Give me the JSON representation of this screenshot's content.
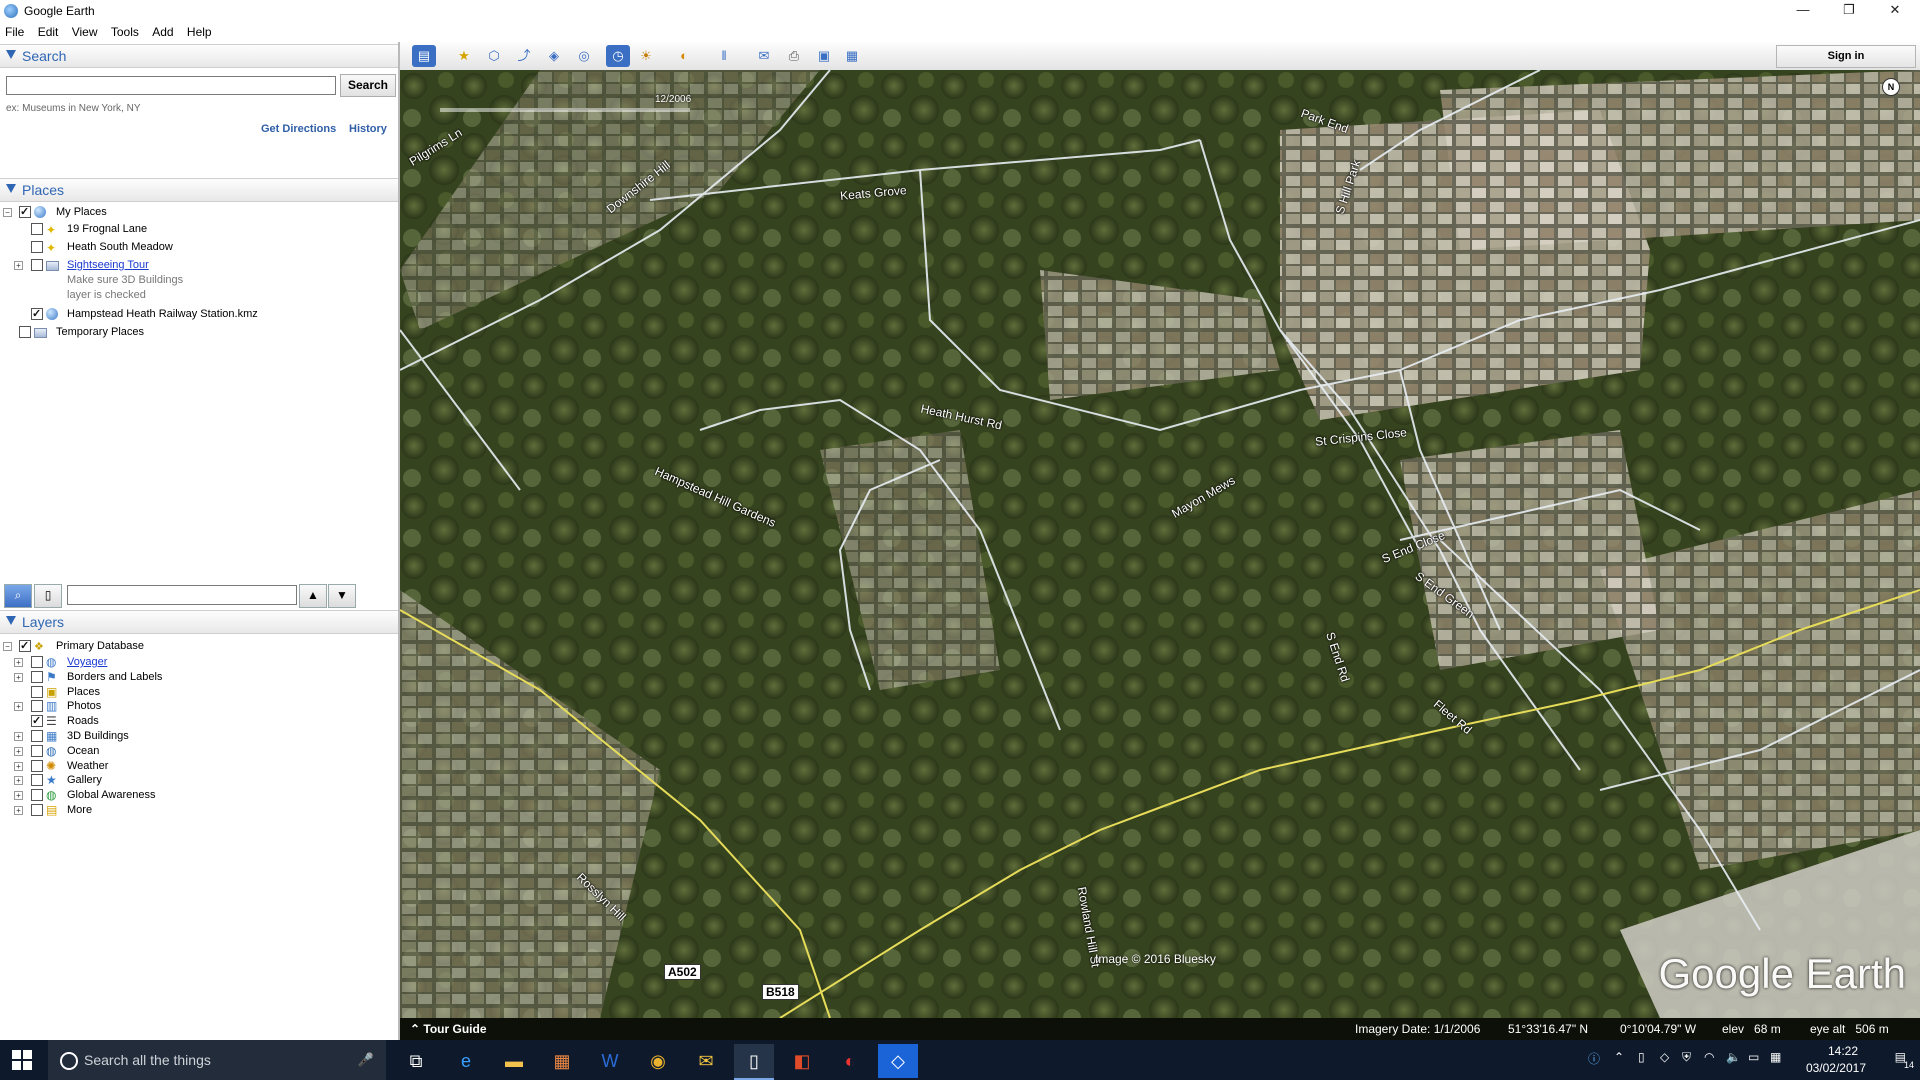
{
  "window": {
    "title": "Google Earth",
    "minimize": "—",
    "maximize": "❐",
    "close": "✕"
  },
  "menu": [
    "File",
    "Edit",
    "View",
    "Tools",
    "Add",
    "Help"
  ],
  "search": {
    "header": "Search",
    "button": "Search",
    "hint": "ex: Museums in New York, NY",
    "get_directions": "Get Directions",
    "history": "History",
    "value": ""
  },
  "places": {
    "header": "Places",
    "root": "My Places",
    "items": [
      {
        "label": "19 Frognal Lane",
        "checked": false
      },
      {
        "label": "Heath South Meadow",
        "checked": false
      },
      {
        "label": "Sightseeing Tour",
        "checked": false,
        "note1": "Make sure 3D Buildings",
        "note2": "layer is checked"
      },
      {
        "label": "Hampstead Heath Railway Station.kmz",
        "checked": true
      }
    ],
    "temporary": "Temporary Places"
  },
  "layers": {
    "header": "Layers",
    "root": "Primary Database",
    "items": [
      {
        "label": "Voyager",
        "checked": false,
        "link": true
      },
      {
        "label": "Borders and Labels",
        "checked": false
      },
      {
        "label": "Places",
        "checked": false
      },
      {
        "label": "Photos",
        "checked": false
      },
      {
        "label": "Roads",
        "checked": true
      },
      {
        "label": "3D Buildings",
        "checked": false
      },
      {
        "label": "Ocean",
        "checked": false
      },
      {
        "label": "Weather",
        "checked": false
      },
      {
        "label": "Gallery",
        "checked": false
      },
      {
        "label": "Global Awareness",
        "checked": false
      },
      {
        "label": "More",
        "checked": false
      }
    ]
  },
  "toolbar": {
    "sign_in": "Sign in"
  },
  "map": {
    "date_slider_label": "12/2006",
    "north": "N",
    "roads": {
      "pilgrims": "Pilgrims Ln",
      "downshire": "Downshire Hill",
      "keats": "Keats Grove",
      "parkend": "Park End",
      "southhill": "S Hill Park",
      "heathhurst": "Heath Hurst Rd",
      "stcrispins": "St Crispins Close",
      "hampsteadhill": "Hampstead Hill Gardens",
      "mayon": "Mayon Mews",
      "sendclose": "S End Close",
      "sendgreen": "S End Green",
      "sendrd": "S End Rd",
      "fleetrd": "Fleet Rd",
      "rosslyn": "Rosslyn Hill",
      "rowland": "Rowland Hill St"
    },
    "shields": {
      "a502": "A502",
      "b518": "B518"
    },
    "imagery_credit": "Image © 2016 Bluesky",
    "watermark": "Google Earth",
    "tour_guide": "Tour Guide",
    "status": {
      "imagery_date": "Imagery Date: 1/1/2006",
      "lat": "51°33'16.47\" N",
      "lon": "0°10'04.79\" W",
      "elev": "elev   68 m",
      "eye_alt": "eye alt   506 m"
    }
  },
  "taskbar": {
    "search_placeholder": "Search all the things",
    "time": "14:22",
    "date": "03/02/2017",
    "notification_count": "14"
  }
}
